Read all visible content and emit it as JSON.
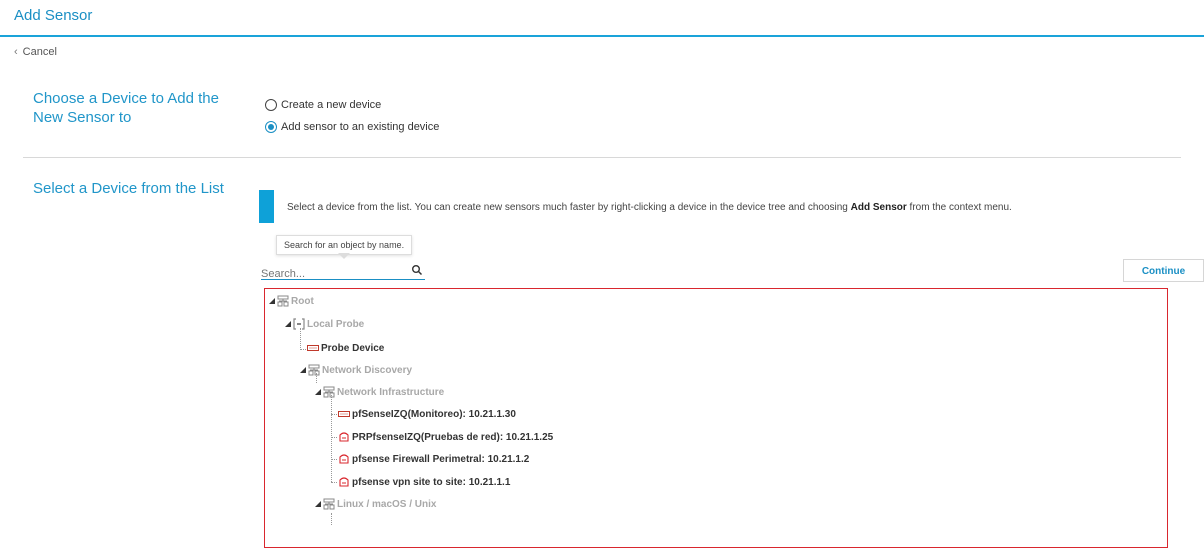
{
  "header": {
    "title": "Add Sensor"
  },
  "nav": {
    "cancel_label": "Cancel"
  },
  "choose_section": {
    "title": "Choose a Device to Add the New Sensor to",
    "options": [
      {
        "label": "Create a new device",
        "checked": false
      },
      {
        "label": "Add sensor to an existing device",
        "checked": true
      }
    ]
  },
  "select_section": {
    "title": "Select a Device from the List",
    "info_text_before": "Select a device from the list. You can create new sensors much faster by right-clicking a device in the device tree and choosing ",
    "info_text_bold": "Add Sensor",
    "info_text_after": " from the context menu.",
    "tooltip": "Search for an object by name.",
    "search_placeholder": "Search...",
    "continue_label": "Continue"
  },
  "tree": {
    "root": "Root",
    "local_probe": "Local Probe",
    "probe_device": "Probe Device",
    "network_discovery": "Network Discovery",
    "network_infrastructure": "Network Infrastructure",
    "dev1": "pfSenseIZQ(Monitoreo): 10.21.1.30",
    "dev2": "PRPfsenseIZQ(Pruebas de red): 10.21.1.25",
    "dev3": "pfsense Firewall Perimetral: 10.21.1.2",
    "dev4": "pfsense vpn site to site: 10.21.1.1",
    "linux": "Linux / macOS / Unix"
  },
  "colors": {
    "accent": "#1a8fc4",
    "tree_border": "#d9272e",
    "device_alert": "#d9272e"
  }
}
